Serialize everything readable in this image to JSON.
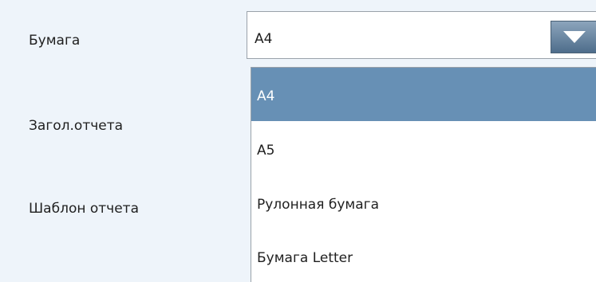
{
  "form": {
    "labels": {
      "paper": "Бумага",
      "report_header": "Загол.отчета",
      "report_template": "Шаблон отчета"
    },
    "paper_select": {
      "value": "A4",
      "options": [
        "A4",
        "A5",
        "Рулонная бумага",
        "Бумага Letter"
      ],
      "selected_index": 0,
      "expanded": true
    }
  },
  "icons": {
    "dropdown_arrow": "chevron-down-icon"
  },
  "colors": {
    "background": "#eef4fa",
    "highlight": "#6790b5",
    "arrow_button": "#5b7a97"
  }
}
